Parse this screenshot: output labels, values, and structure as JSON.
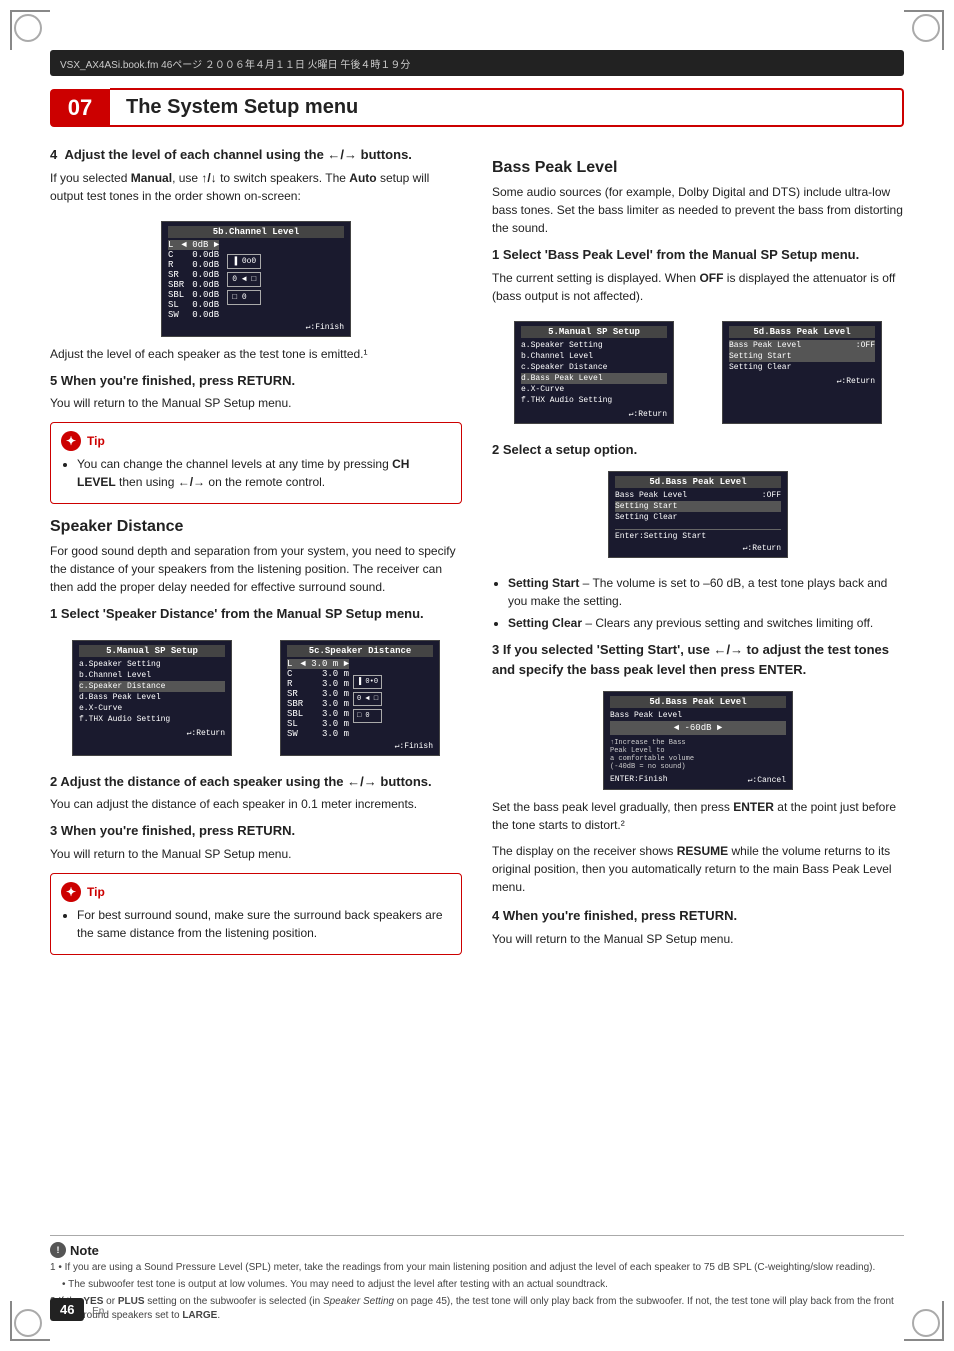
{
  "meta": {
    "chapter_number": "07",
    "chapter_title": "The System Setup menu",
    "top_bar_text": "VSX_AX4ASi.book.fm  46ページ  ２００６年４月１１日  火曜日  午後４時１９分",
    "page_number": "46",
    "page_suffix": "En"
  },
  "left_col": {
    "step4_heading": "4   Adjust the level of each channel using the ←/→ buttons.",
    "step4_para1": "If you selected Manual, use ↑/↓ to switch speakers. The Auto setup will output test tones in the order shown on-screen:",
    "step4_para2": "Adjust the level of each speaker as the test tone is emitted.¹",
    "step5_heading": "5   When you're finished, press RETURN.",
    "step5_para": "You will return to the Manual SP Setup menu.",
    "tip1_header": "Tip",
    "tip1_bullet": "You can change the channel levels at any time by pressing CH LEVEL then using ←/→ on the remote control.",
    "speaker_distance_heading": "Speaker Distance",
    "speaker_distance_para": "For good sound depth and separation from your system, you need to specify the distance of your speakers from the listening position. The receiver can then add the proper delay needed for effective surround sound.",
    "sd_step1_heading": "1   Select 'Speaker Distance' from the Manual SP Setup menu.",
    "sd_step2_heading": "2   Adjust the distance of each speaker using the ←/→ buttons.",
    "sd_step2_para": "You can adjust the distance of each speaker in 0.1 meter increments.",
    "sd_step3_heading": "3   When you're finished, press RETURN.",
    "sd_step3_para": "You will return to the Manual SP Setup menu.",
    "tip2_header": "Tip",
    "tip2_bullet": "For best surround sound, make sure the surround back speakers are the same distance from the listening position."
  },
  "right_col": {
    "bass_peak_heading": "Bass Peak Level",
    "bass_peak_para1": "Some audio sources (for example, Dolby Digital and DTS) include ultra-low bass tones. Set the bass limiter as needed to prevent the bass from distorting the sound.",
    "bp_step1_heading": "1   Select 'Bass Peak Level' from the Manual SP Setup menu.",
    "bp_step1_para": "The current setting is displayed. When OFF is displayed the attenuator is off (bass output is not affected).",
    "bp_step2_heading": "2   Select a setup option.",
    "bullet_setting_start": "Setting Start – The volume is set to –60 dB, a test tone plays back and you make the setting.",
    "bullet_setting_clear": "Setting Clear – Clears any previous setting and switches limiting off.",
    "bp_step3_heading": "3   If you selected 'Setting Start', use ←/→ to adjust the test tones and specify the bass peak level then press ENTER.",
    "bp_step3_para1": "Set the bass peak level gradually, then press ENTER at the point just before the tone starts to distort.²",
    "bp_step3_para2": "The display on the receiver shows RESUME while the volume returns to its original position, then you automatically return to the main Bass Peak Level menu.",
    "bp_step4_heading": "4   When you're finished, press RETURN.",
    "bp_step4_para": "You will return to the Manual SP Setup menu."
  },
  "screens": {
    "channel_level": {
      "title": "5b.Channel Level",
      "rows": [
        {
          "ch": "L",
          "val": "◄ 0dB ►"
        },
        {
          "ch": "C",
          "val": "  0.0dB"
        },
        {
          "ch": "R",
          "val": "  0.0dB"
        },
        {
          "ch": "SR",
          "val": "  0.0dB"
        },
        {
          "ch": "SBR",
          "val": "  0.0dB"
        },
        {
          "ch": "SBL",
          "val": "  0.0dB"
        },
        {
          "ch": "SL",
          "val": "  0.0dB"
        },
        {
          "ch": "SW",
          "val": "  0.0dB"
        }
      ],
      "footer": "↵:Finish"
    },
    "speaker_distance": {
      "left_title": "5.Manual SP Setup",
      "left_rows": [
        "a.Speaker Setting",
        "b.Channel Level",
        "c.Speaker Distance",
        "d.Bass Peak Level",
        "e.X-Curve",
        "f.THX Audio Setting"
      ],
      "left_footer": "↵:Return",
      "right_title": "5c.Speaker Distance",
      "right_rows": [
        {
          "ch": "L",
          "val": "◄ 3.0 m ►"
        },
        {
          "ch": "C",
          "val": "   3.0 m"
        },
        {
          "ch": "R",
          "val": "   3.0 m"
        },
        {
          "ch": "SR",
          "val": "   3.0 m"
        },
        {
          "ch": "SBR",
          "val": "   3.0 m"
        },
        {
          "ch": "SBL",
          "val": "   3.0 m"
        },
        {
          "ch": "SL",
          "val": "   3.0 m"
        },
        {
          "ch": "SW",
          "val": "   3.0 m"
        }
      ],
      "right_footer": "↵:Finish"
    },
    "bass_peak_setup": {
      "left_title": "5.Manual SP Setup",
      "left_rows": [
        "a.Speaker Setting",
        "b.Channel Level",
        "c.Speaker Distance",
        "d.Bass Peak Level",
        "e.X-Curve",
        "f.THX Audio Setting"
      ],
      "left_footer": "↵:Return",
      "right_title": "5d.Bass Peak Level",
      "right_rows": [
        "Bass Peak Level  :OFF",
        "Setting Start",
        "Setting Clear"
      ],
      "right_footer": "↵:Return"
    },
    "bass_peak_option": {
      "title": "5d.Bass Peak Level",
      "rows": [
        "Bass Peak Level  :OFF",
        "Setting Start",
        "Setting Clear"
      ],
      "enter": "Enter:Setting Start",
      "footer": "↵:Return"
    },
    "bass_peak_adjust": {
      "title": "5d.Bass Peak Level",
      "row1": "Bass Peak Level",
      "row2": "◄ -60dB ►",
      "hint1": "↑Increase the Bass",
      "hint2": "Peak Level to",
      "hint3": "a comfortable volume",
      "hint4": "(-40dB = no sound)",
      "footer1": "ENTER:Finish",
      "footer2": "↵:Cancel"
    }
  },
  "notes": {
    "header": "Note",
    "note1": "1  • If you are using a Sound Pressure Level (SPL) meter, take the readings from your main listening position and adjust the level of each speaker to 75 dB SPL (C-weighting/slow reading).",
    "note1b": "   • The subwoofer test tone is output at low volumes. You may need to adjust the level after testing with an actual soundtrack.",
    "note2": "2  If the YES or PLUS setting on the subwoofer is selected (in Speaker Setting on page 45), the test tone will only play back from the subwoofer. If not, the test tone will play back from the front and surround speakers set to LARGE."
  }
}
